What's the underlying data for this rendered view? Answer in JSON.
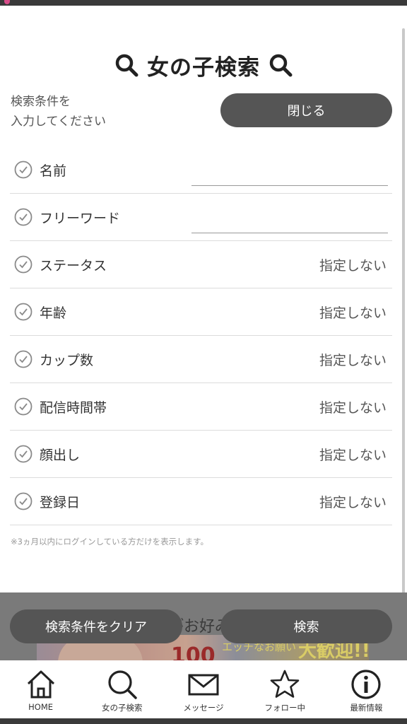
{
  "header": {
    "title": "女の子検索"
  },
  "instruction": {
    "line1": "検索条件を",
    "line2": "入力してください"
  },
  "close_button": "閉じる",
  "fields": [
    {
      "label": "名前",
      "type": "text",
      "value": ""
    },
    {
      "label": "フリーワード",
      "type": "text",
      "value": ""
    },
    {
      "label": "ステータス",
      "type": "select",
      "value": "指定しない"
    },
    {
      "label": "年齢",
      "type": "select",
      "value": "指定しない"
    },
    {
      "label": "カップ数",
      "type": "select",
      "value": "指定しない"
    },
    {
      "label": "配信時間帯",
      "type": "select",
      "value": "指定しない"
    },
    {
      "label": "顔出し",
      "type": "select",
      "value": "指定しない"
    },
    {
      "label": "登録日",
      "type": "select",
      "value": "指定しない"
    }
  ],
  "note": "※3ヵ月以内にログインしている方だけを表示します。",
  "banner": {
    "text": "がお好み",
    "promo": "大歓迎!!",
    "promo_small": "エッチなお願い",
    "number": "100"
  },
  "actions": {
    "clear_label": "検索条件をクリア",
    "search_label": "検索"
  },
  "tabbar": [
    {
      "label": "HOME",
      "icon": "home-icon"
    },
    {
      "label": "女の子検索",
      "icon": "search-icon"
    },
    {
      "label": "メッセージ",
      "icon": "mail-icon"
    },
    {
      "label": "フォロー中",
      "icon": "star-icon"
    },
    {
      "label": "最新情報",
      "icon": "info-icon"
    }
  ],
  "colors": {
    "button_bg": "#555555",
    "title": "#222222",
    "divider": "#dcdcdc"
  }
}
